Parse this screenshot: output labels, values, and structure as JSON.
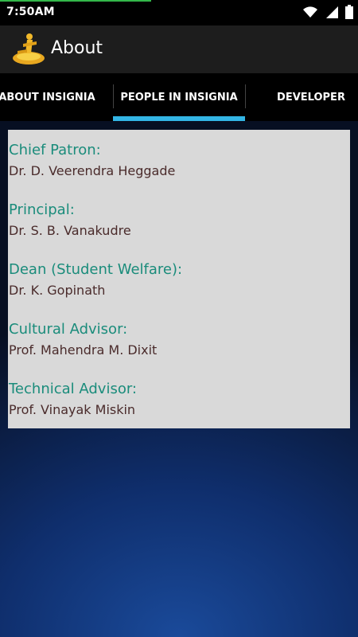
{
  "status_bar": {
    "time": "7:50AM",
    "icons": [
      "wifi-icon",
      "signal-icon",
      "battery-icon"
    ]
  },
  "action_bar": {
    "title": "About",
    "icon": "app-logo-icon"
  },
  "tabs": [
    {
      "label": "ABOUT INSIGNIA"
    },
    {
      "label": "PEOPLE IN INSIGNIA",
      "selected": true
    },
    {
      "label": "DEVELOPER"
    }
  ],
  "people": [
    {
      "role": "Chief Patron:",
      "name": "Dr. D. Veerendra Heggade"
    },
    {
      "role": "Principal:",
      "name": "Dr. S. B. Vanakudre"
    },
    {
      "role": "Dean (Student Welfare):",
      "name": "Dr. K. Gopinath"
    },
    {
      "role": "Cultural Advisor:",
      "name": "Prof. Mahendra M. Dixit"
    },
    {
      "role": "Technical Advisor:",
      "name": "Prof. Vinayak Miskin"
    }
  ],
  "colors": {
    "tab_indicator": "#33b5e5",
    "role_text": "#1a8c7b",
    "name_text": "#4a2b2b",
    "card_background": "#d9d9d9"
  }
}
